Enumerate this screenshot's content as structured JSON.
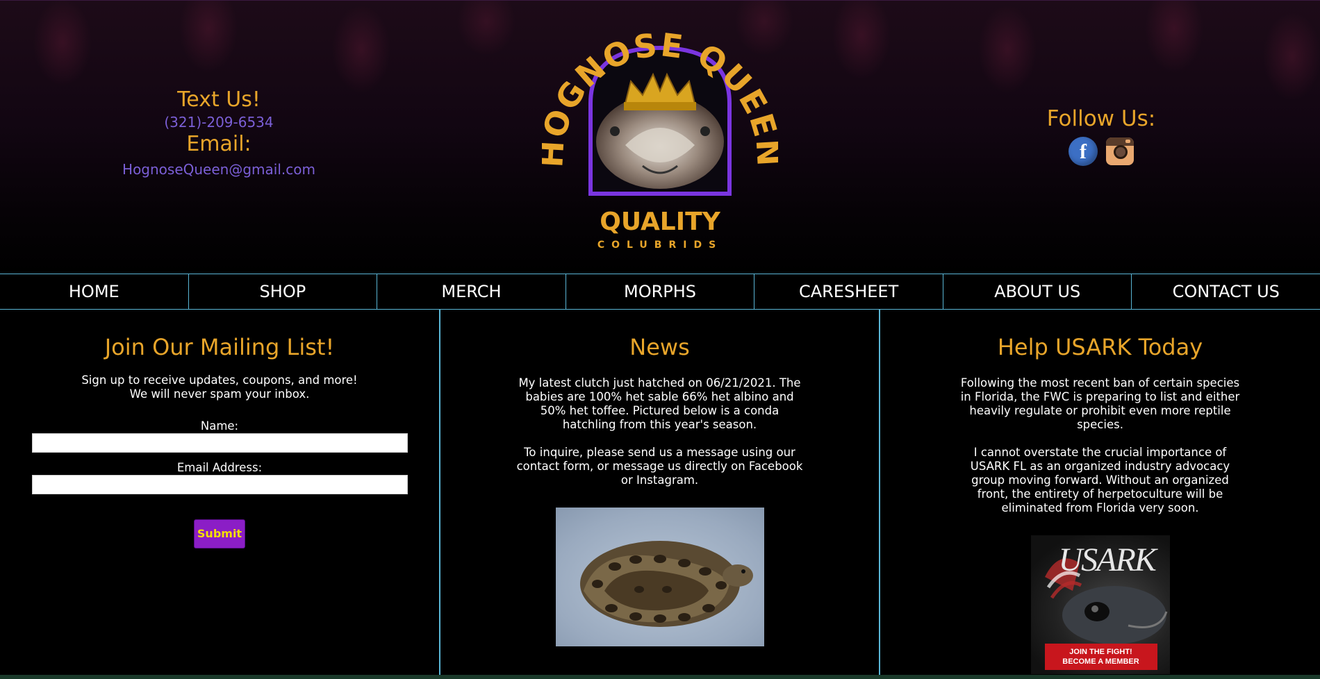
{
  "header": {
    "contact": {
      "text_us_label": "Text Us!",
      "phone": "(321)-209-6534",
      "email_label": "Email:",
      "email": "HognoseQueen@gmail.com"
    },
    "logo": {
      "arc_text": "HOGNOSE QUEEN",
      "line1": "QUALITY",
      "line2": "COLUBRIDS"
    },
    "follow": {
      "label": "Follow Us:",
      "icons": [
        "facebook-icon",
        "instagram-icon"
      ]
    }
  },
  "nav": {
    "items": [
      {
        "label": "HOME"
      },
      {
        "label": "SHOP"
      },
      {
        "label": "MERCH"
      },
      {
        "label": "MORPHS"
      },
      {
        "label": "CARESHEET"
      },
      {
        "label": "ABOUT US"
      },
      {
        "label": "CONTACT US"
      }
    ]
  },
  "mailing": {
    "title": "Join Our Mailing List!",
    "intro_line1": "Sign up to receive updates, coupons, and more!",
    "intro_line2": "We will never spam your inbox.",
    "name_label": "Name:",
    "name_value": "",
    "email_label": "Email Address:",
    "email_value": "",
    "submit_label": "Submit"
  },
  "news": {
    "title": "News",
    "paragraph1": "My latest clutch just hatched on 06/21/2021. The babies are 100% het sable 66% het albino and 50% het toffee. Pictured below is a conda hatchling from this year's season.",
    "paragraph2": "To inquire, please send us a message using our contact form, or message us directly on Facebook or Instagram."
  },
  "usark": {
    "title": "Help USARK Today",
    "paragraph1": "Following the most recent ban of certain species in Florida, the FWC is preparing to list and either heavily regulate or prohibit even more reptile species.",
    "paragraph2": "I cannot overstate the crucial importance of USARK FL as an organized industry advocacy group moving forward. Without an organized front, the entirety of herpetoculture will be eliminated from Florida very soon.",
    "banner_title": "USARK",
    "banner_line1": "JOIN THE FIGHT!",
    "banner_line2": "BECOME A MEMBER"
  },
  "colors": {
    "gold": "#e8a52a",
    "link_purple": "#7b5fd6",
    "nav_border": "#5ab6d6",
    "submit_bg": "#8b1ec6",
    "submit_text": "#f4df00"
  }
}
